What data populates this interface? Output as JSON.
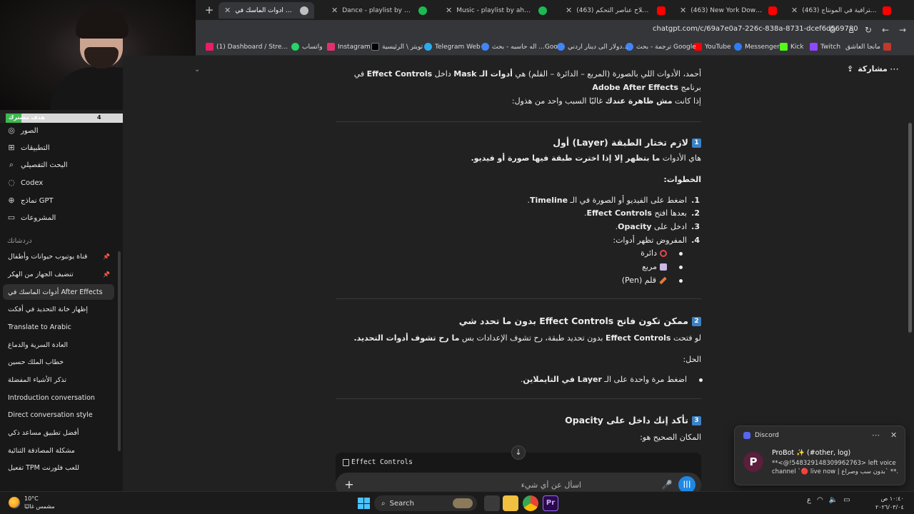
{
  "tabs": [
    {
      "label": "أدوات الماسك في After Effects",
      "icon_color": "#bfbfbf",
      "active": true
    },
    {
      "label": "Dance - playlist by ahmad baa",
      "icon_color": "#1db954"
    },
    {
      "label": "Music - playlist by ahmad baa",
      "icon_color": "#1db954"
    },
    {
      "label": "(463) كيفية إصلاح عناصر التحكم",
      "icon_color": "#ff0000"
    },
    {
      "label": "(463) New York Downpour, Wa",
      "icon_color": "#ff0000"
    },
    {
      "label": "(463) انتقالات احترافية في المونتاج",
      "icon_color": "#ff0000"
    }
  ],
  "address": {
    "url": "chatgpt.com/c/69a7e0a7-226c-838a-8731-dcef6d569780"
  },
  "bookmarks": [
    {
      "label": "مانجا العاشق",
      "color": "#c0392b"
    },
    {
      "label": "Twitch",
      "color": "#9146ff"
    },
    {
      "label": "Kick",
      "color": "#53fc18"
    },
    {
      "label": "Messenger",
      "color": "#2f7cf6"
    },
    {
      "label": "YouTube",
      "color": "#ff0000"
    },
    {
      "label": "ترجمة - بحث Google",
      "color": "#4285f4"
    },
    {
      "label": "دولار الى دينار اردني...",
      "color": "#4285f4"
    },
    {
      "label": "اله حاسبه - بحث ...Goo",
      "color": "#4285f4"
    },
    {
      "label": "Telegram Web",
      "color": "#2aabee"
    },
    {
      "label": "تويتر \\ الرئيسية",
      "color": "#000000"
    },
    {
      "label": "Instagram",
      "color": "#e1306c"
    },
    {
      "label": "واتساب",
      "color": "#25d366"
    },
    {
      "label": "(1) Dashboard / Stre...",
      "color": "#e91e63"
    }
  ],
  "goal": {
    "label": "هدف مشترك",
    "current": "4",
    "max": "50",
    "progress": 0.08
  },
  "sidebar": {
    "top_items": [
      {
        "label": "الصور",
        "icon": "images-icon",
        "glyph": "◎"
      },
      {
        "label": "التطبيقات",
        "icon": "apps-icon",
        "glyph": "⊞"
      },
      {
        "label": "البحث التفصيلي",
        "icon": "deep-research-icon",
        "glyph": "⌕"
      },
      {
        "label": "Codex",
        "icon": "codex-icon",
        "glyph": "◌"
      },
      {
        "label": "نماذج GPT",
        "icon": "gpts-icon",
        "glyph": "⊕"
      },
      {
        "label": "المشروعات",
        "icon": "projects-icon",
        "glyph": "▭"
      }
    ],
    "section_label": "دردشاتك",
    "chats": [
      {
        "label": "قناة يوتيوب حيوانات وأطفال",
        "pinned": true
      },
      {
        "label": "تنضيف الجهاز من الهكر",
        "pinned": true
      },
      {
        "label": "أدوات الماسك في After Effects",
        "active": true
      },
      {
        "label": "إظهار خانة التحديد في أفكت"
      },
      {
        "label": "Translate to Arabic"
      },
      {
        "label": "العادة السرية والدماغ"
      },
      {
        "label": "خطاب الملك حسين"
      },
      {
        "label": "تذكر الأشياء المفضلة"
      },
      {
        "label": "Introduction conversation"
      },
      {
        "label": "Direct conversation style"
      },
      {
        "label": "أفضل تطبيق مساعد ذكي"
      },
      {
        "label": "مشكلة المصادقة الثنائية"
      },
      {
        "label": "تفعيل TPM للعب فلورنت"
      }
    ]
  },
  "header": {
    "share_label": "مشاركة"
  },
  "content": {
    "intro_1a": "أحمد، الأدوات اللي بالصورة (المربع – الدائرة – القلم) هي ",
    "intro_1b": "أدوات الـ Mask",
    "intro_1c": " داخل ",
    "intro_1d": "Effect Controls",
    "intro_1e": " في برنامج ",
    "intro_1f": "Adobe After Effects",
    "intro_2a": "إذا كانت ",
    "intro_2b": "مش ظاهرة عندك",
    "intro_2c": " غالبًا السبب واحد من هذول:",
    "s1_num": "1",
    "s1_title": "لازم تختار الطبقة (Layer) أول",
    "s1_p_a": "هاي الأدوات ",
    "s1_p_b": "ما بتظهر إلا إذا اخترت طبقة فيها صورة أو فيديو.",
    "steps_label": "الخطوات:",
    "steps": [
      {
        "n": "1.",
        "a": "اضغط على الفيديو أو الصورة في الـ ",
        "b": "Timeline",
        "c": "."
      },
      {
        "n": "2.",
        "a": "بعدها افتح ",
        "b": "Effect Controls",
        "c": "."
      },
      {
        "n": "3.",
        "a": "ادخل على ",
        "b": "Opacity",
        "c": "."
      },
      {
        "n": "4.",
        "a": "المفروض تظهر أدوات:",
        "b": "",
        "c": ""
      }
    ],
    "tools": [
      "دائرة",
      "مربع",
      "قلم (Pen)"
    ],
    "s2_num": "2",
    "s2_title": "ممكن تكون فاتح Effect Controls بدون ما تحدد شي",
    "s2_p_a": "لو فتحت ",
    "s2_p_b": "Effect Controls",
    "s2_p_c": " بدون تحديد طبقة، رح تشوف الإعدادات بس ",
    "s2_p_d": "ما رح تشوف أدوات التحديد.",
    "solution_label": "الحل:",
    "solution_a": "اضغط مرة واحدة على الـ ",
    "solution_b": "Layer في التايملاين",
    "solution_c": ".",
    "s3_num": "3",
    "s3_title": "تأكد إنك داخل على Opacity",
    "s3_p": "المكان الصحيح هو:",
    "code": "Effect Controls"
  },
  "composer": {
    "placeholder": "اسأل عن أي شيء"
  },
  "toast": {
    "app": "Discord",
    "title": "ProBot ✨ (#other, log)",
    "body": "**<@!548329148309962763> left voice channel `🔴 live now | بدون سب وصراع` **."
  },
  "taskbar": {
    "temp": "10°C",
    "weather": "مشمس غالبًا",
    "search_label": "Search",
    "time": "١٠:٤٠ ص",
    "date": "٢٠٢٦/٠٣/٠٤",
    "lang": "ع"
  }
}
